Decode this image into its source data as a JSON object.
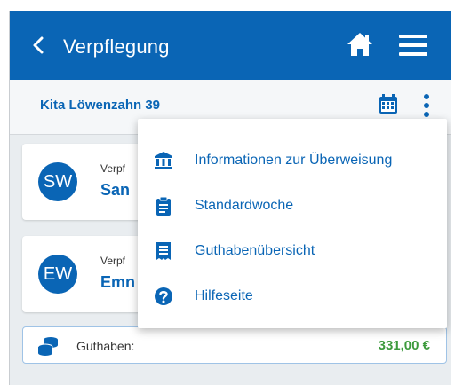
{
  "header": {
    "title": "Verpflegung"
  },
  "subheader": {
    "location": "Kita Löwenzahn 39"
  },
  "children": [
    {
      "initials": "SW",
      "label": "Verpf",
      "name": "San"
    },
    {
      "initials": "EW",
      "label": "Verpf",
      "name": "Emn"
    }
  ],
  "balance": {
    "label": "Guthaben:",
    "value": "331,00 €"
  },
  "menu": {
    "items": [
      {
        "label": "Informationen zur Überweisung",
        "icon": "bank-icon"
      },
      {
        "label": "Standardwoche",
        "icon": "clipboard-icon"
      },
      {
        "label": "Guthabenübersicht",
        "icon": "receipt-icon"
      },
      {
        "label": "Hilfeseite",
        "icon": "help-icon"
      }
    ]
  },
  "colors": {
    "primary": "#0a65b5",
    "balance_positive": "#3d9a3d"
  }
}
